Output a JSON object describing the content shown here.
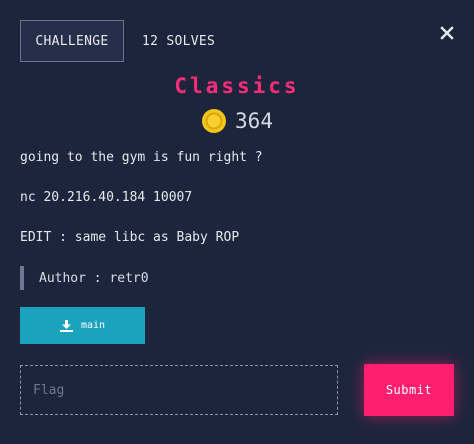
{
  "tabs": [
    {
      "label": "CHALLENGE",
      "active": true
    },
    {
      "label": "12 SOLVES",
      "active": false
    }
  ],
  "close_icon": "close-icon",
  "challenge": {
    "name": "Classics",
    "points": "364",
    "coin_icon": "coin-icon",
    "description_lines": [
      "going to the gym is fun right ?",
      "nc 20.216.40.184 10007",
      "EDIT : same libc as Baby ROP"
    ],
    "author": "Author : retr0"
  },
  "download": {
    "label": "main",
    "icon": "download-icon"
  },
  "flag_form": {
    "placeholder": "Flag",
    "value": "",
    "submit_label": "Submit"
  },
  "colors": {
    "background": "#1d253d",
    "title": "#ff2d78",
    "download_button": "#1ba3bd",
    "submit_button": "#ff1f6e",
    "coin": "#f5c518"
  }
}
